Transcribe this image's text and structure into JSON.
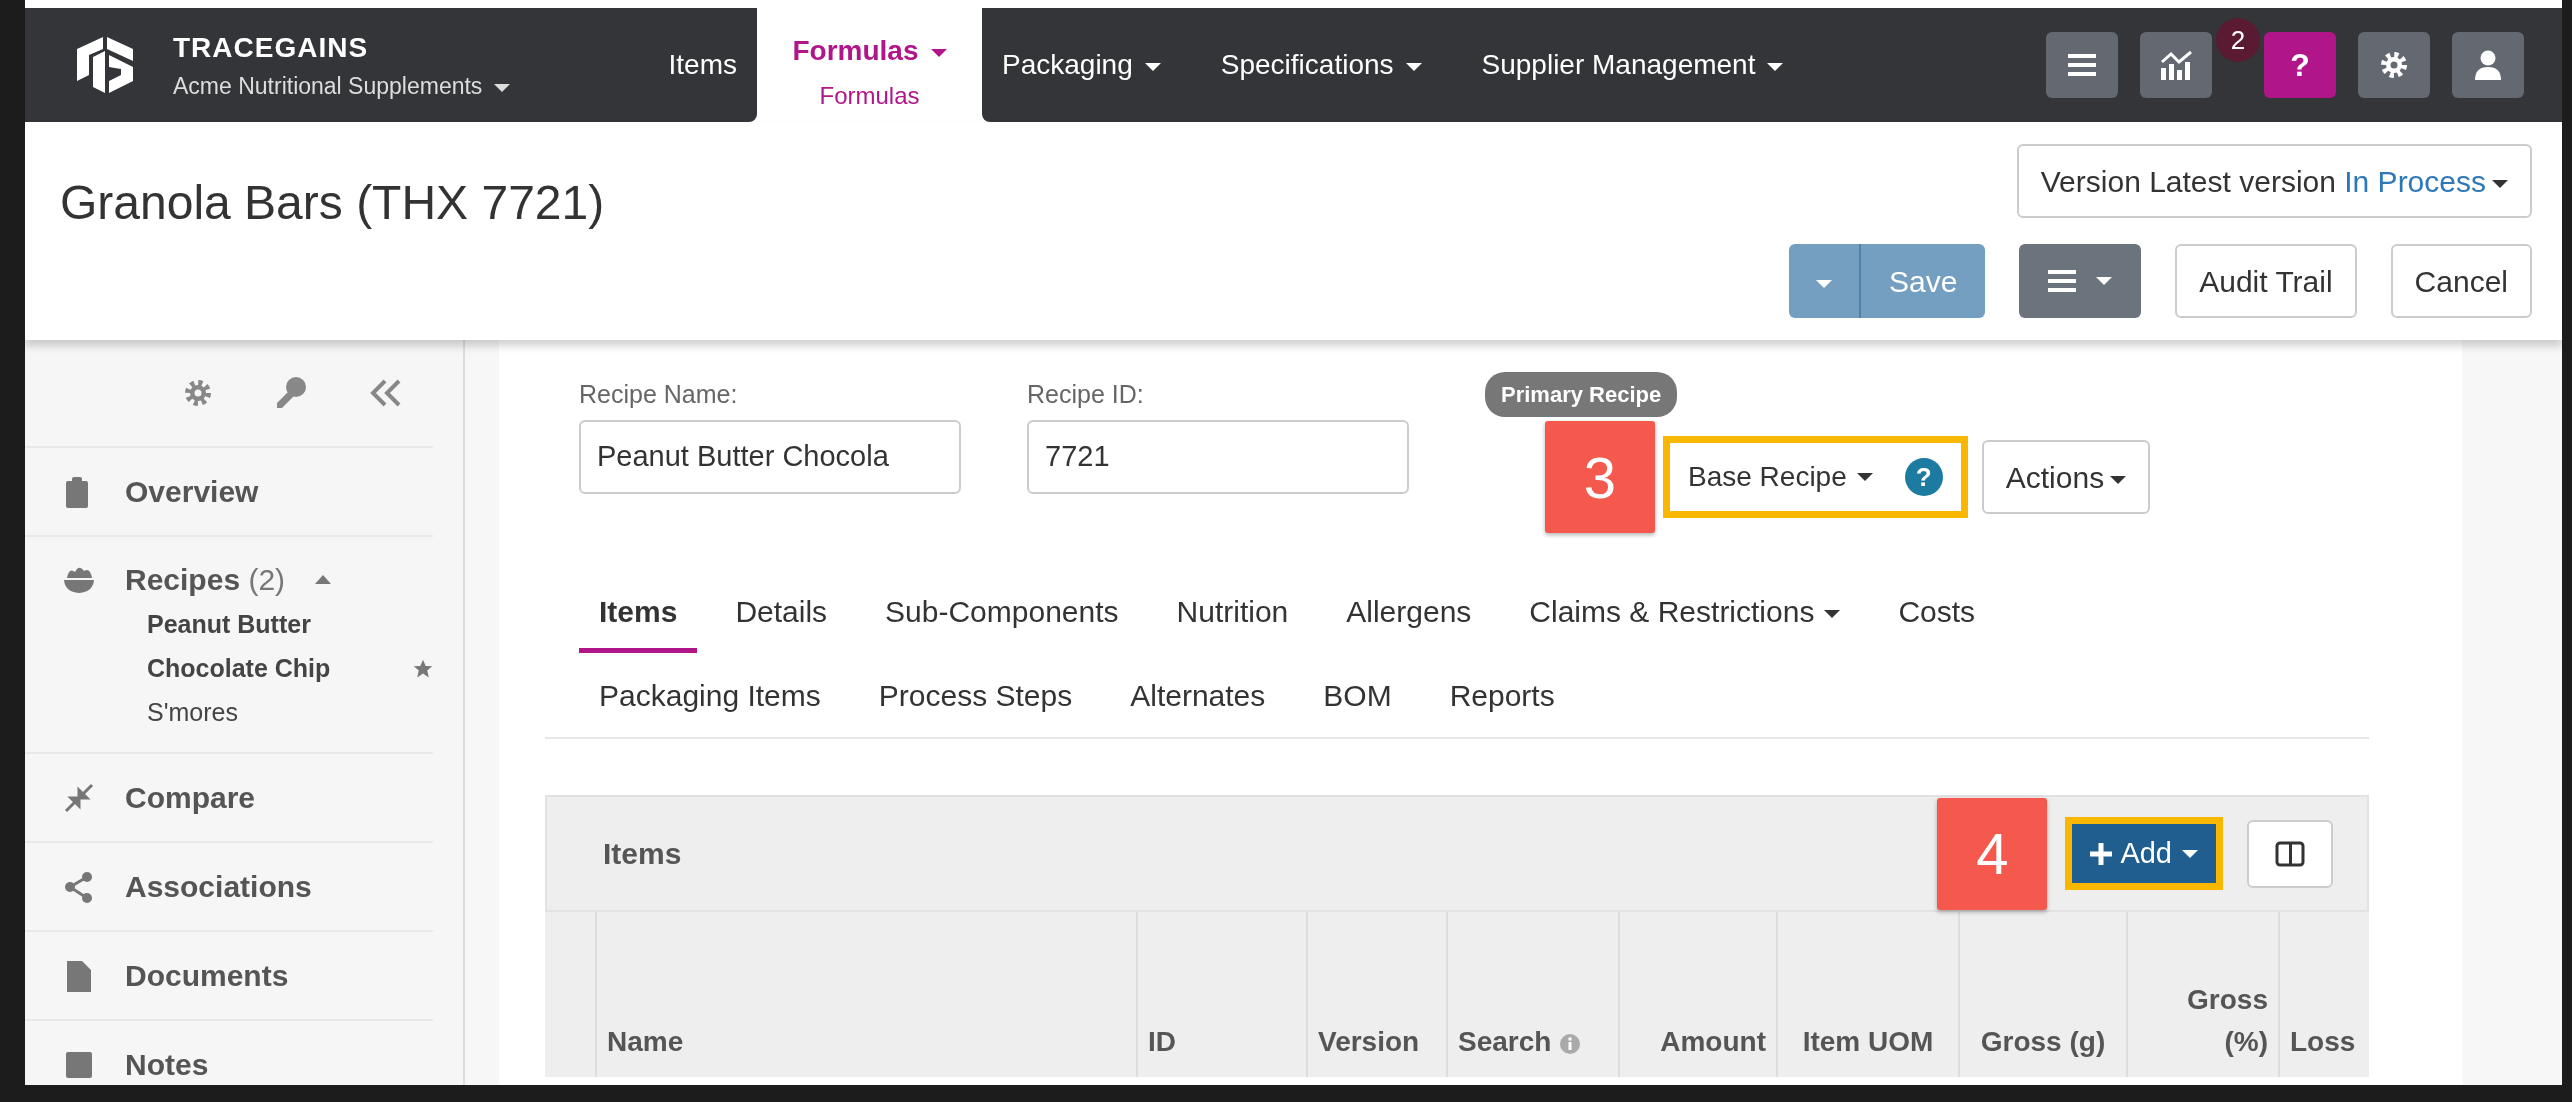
{
  "brand": {
    "name": "TRACEGAINS",
    "account": "Acme Nutritional Supplements"
  },
  "nav": [
    {
      "label": "Items",
      "dropdown": false,
      "selected": false
    },
    {
      "label": "Formulas",
      "dropdown": true,
      "selected": true,
      "sublabel": "Formulas"
    },
    {
      "label": "Packaging",
      "dropdown": true,
      "selected": false
    },
    {
      "label": "Specifications",
      "dropdown": true,
      "selected": false
    },
    {
      "label": "Supplier Management",
      "dropdown": true,
      "selected": false
    }
  ],
  "toolbar": [
    {
      "kind": "menu",
      "selected": false
    },
    {
      "kind": "chart",
      "selected": false,
      "badge": "2"
    },
    {
      "kind": "help",
      "selected": true,
      "glyph": "?"
    },
    {
      "kind": "settings",
      "selected": false
    },
    {
      "kind": "user",
      "selected": false
    }
  ],
  "page_title": "Granola Bars (THX 7721)",
  "version": {
    "label": "Version Latest version",
    "status": "In Process"
  },
  "header_buttons": {
    "save": "Save",
    "audit": "Audit Trail",
    "cancel": "Cancel"
  },
  "sidebar": {
    "items": [
      {
        "kind": "overview",
        "label": "Overview"
      },
      {
        "kind": "recipes",
        "label": "Recipes",
        "count": "(2)",
        "expanded": true,
        "children": [
          {
            "label": "Peanut Butter Chocolate Chip",
            "primary": true
          },
          {
            "label": "S'mores",
            "primary": false
          }
        ]
      },
      {
        "kind": "compare",
        "label": "Compare"
      },
      {
        "kind": "associations",
        "label": "Associations"
      },
      {
        "kind": "documents",
        "label": "Documents"
      },
      {
        "kind": "notes",
        "label": "Notes"
      }
    ]
  },
  "recipe": {
    "fields": [
      {
        "label": "Recipe Name:",
        "value": "Peanut Butter Chocola"
      },
      {
        "label": "Recipe ID:",
        "value": "7721"
      }
    ],
    "badge": "Primary Recipe",
    "base_recipe": "Base Recipe",
    "help": "?",
    "actions": "Actions"
  },
  "callouts": [
    "3",
    "4"
  ],
  "tabs": [
    [
      {
        "label": "Items",
        "selected": true,
        "dropdown": false
      },
      {
        "label": "Details",
        "selected": false,
        "dropdown": false
      },
      {
        "label": "Sub-Components",
        "selected": false,
        "dropdown": false
      },
      {
        "label": "Nutrition",
        "selected": false,
        "dropdown": false
      },
      {
        "label": "Allergens",
        "selected": false,
        "dropdown": false
      },
      {
        "label": "Claims & Restrictions",
        "selected": false,
        "dropdown": true
      },
      {
        "label": "Costs",
        "selected": false,
        "dropdown": false
      }
    ],
    [
      {
        "label": "Packaging Items",
        "selected": false,
        "dropdown": false
      },
      {
        "label": "Process Steps",
        "selected": false,
        "dropdown": false
      },
      {
        "label": "Alternates",
        "selected": false,
        "dropdown": false
      },
      {
        "label": "BOM",
        "selected": false,
        "dropdown": false
      },
      {
        "label": "Reports",
        "selected": false,
        "dropdown": false
      }
    ]
  ],
  "items_panel": {
    "title": "Items",
    "add": "Add",
    "columns": [
      {
        "info": false
      },
      {
        "label": "Name",
        "info": false
      },
      {
        "label": "ID",
        "info": false
      },
      {
        "label": "Version",
        "info": false
      },
      {
        "label": "Search",
        "info": true
      },
      {
        "label": "Amount",
        "info": false
      },
      {
        "label": "Item UOM",
        "info": false
      },
      {
        "label": "Gross (g)",
        "info": false
      },
      {
        "label": "Gross (%)",
        "info": false
      },
      {
        "label": "Loss",
        "info": false
      }
    ]
  }
}
